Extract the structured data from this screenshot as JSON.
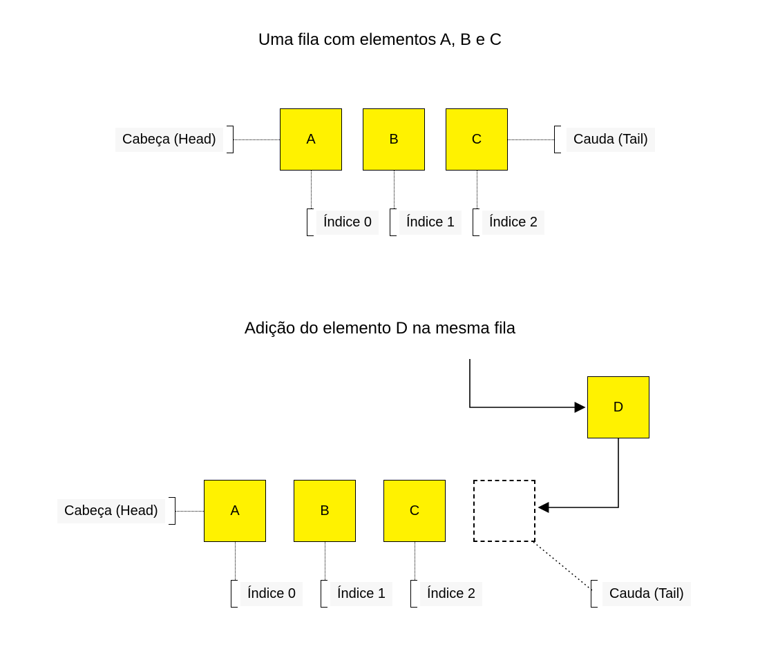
{
  "diagram1": {
    "title": "Uma fila com elementos A, B e C",
    "head_label": "Cabeça (Head)",
    "tail_label": "Cauda (Tail)",
    "nodes": [
      {
        "value": "A",
        "index_label": "Índice 0"
      },
      {
        "value": "B",
        "index_label": "Índice 1"
      },
      {
        "value": "C",
        "index_label": "Índice 2"
      }
    ]
  },
  "diagram2": {
    "title": "Adição do elemento D na mesma fila",
    "head_label": "Cabeça (Head)",
    "tail_label": "Cauda (Tail)",
    "new_node": {
      "value": "D"
    },
    "nodes": [
      {
        "value": "A",
        "index_label": "Índice 0"
      },
      {
        "value": "B",
        "index_label": "Índice 1"
      },
      {
        "value": "C",
        "index_label": "Índice 2"
      }
    ]
  }
}
